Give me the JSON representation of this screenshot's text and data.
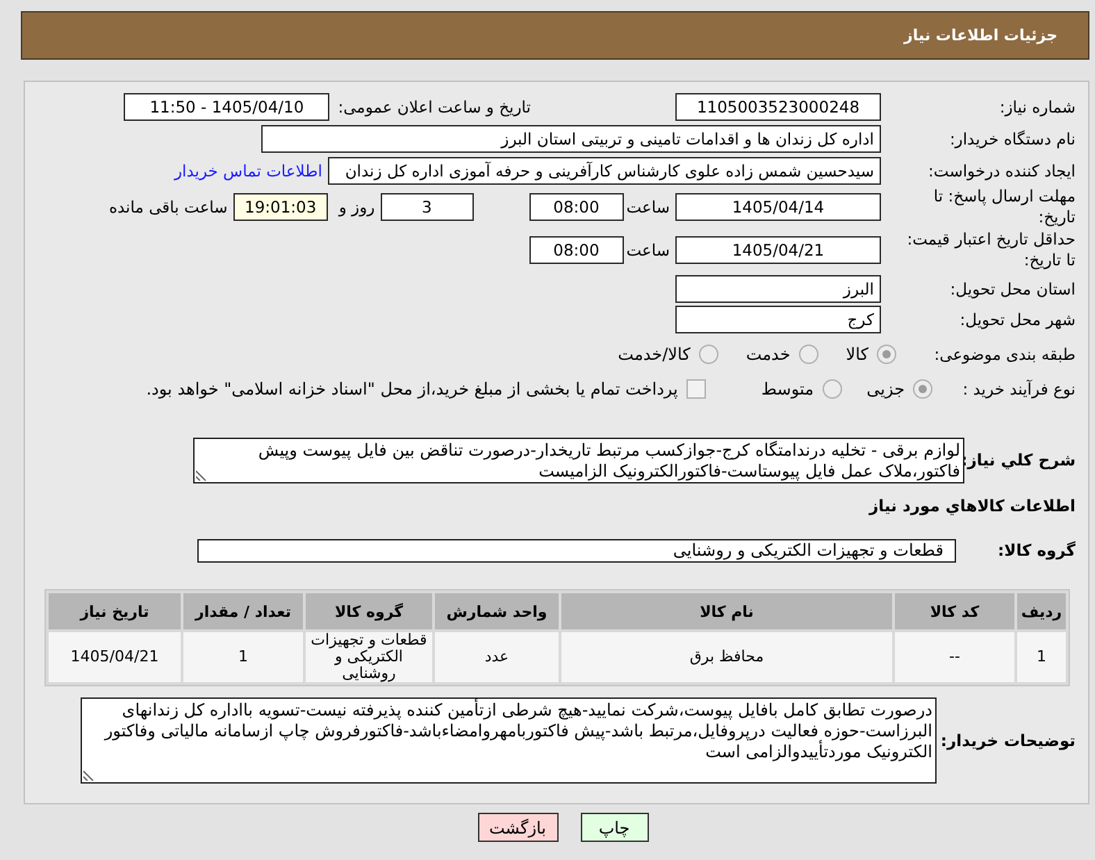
{
  "header": {
    "title": "جزئیات اطلاعات نیاز"
  },
  "form": {
    "need_number": {
      "label": "شماره نیاز:",
      "value": "1105003523000248"
    },
    "announce_datetime": {
      "label": "تاریخ و ساعت اعلان عمومی:",
      "value": "1405/04/10 - 11:50"
    },
    "buyer_org": {
      "label": "نام دستگاه خریدار:",
      "value": "اداره کل زندان ها و اقدامات تامینی و تربیتی استان البرز"
    },
    "requester": {
      "label": "ایجاد کننده درخواست:",
      "value": "سیدحسین شمس زاده علوی کارشناس کارآفرینی و حرفه آموزی اداره کل زندان",
      "link": "اطلاعات تماس خریدار"
    },
    "reply_deadline": {
      "label": "مهلت ارسال پاسخ: تا تاریخ:",
      "date": "1405/04/14",
      "time_label": "ساعت",
      "time": "08:00",
      "days": "3",
      "days_label": "روز و",
      "remaining": "19:01:03",
      "remaining_label": "ساعت باقی مانده"
    },
    "price_validity": {
      "label": "حداقل تاریخ اعتبار قیمت: تا تاریخ:",
      "date": "1405/04/21",
      "time_label": "ساعت",
      "time": "08:00"
    },
    "delivery_province": {
      "label": "استان محل تحویل:",
      "value": "البرز"
    },
    "delivery_city": {
      "label": "شهر محل تحویل:",
      "value": "کرج"
    },
    "category": {
      "label": "طبقه بندی موضوعی:",
      "options": [
        {
          "label": "کالا",
          "selected": true
        },
        {
          "label": "خدمت",
          "selected": false
        },
        {
          "label": "کالا/خدمت",
          "selected": false
        }
      ]
    },
    "purchase_type": {
      "label": "نوع فرآیند خرید :",
      "options": [
        {
          "label": "جزیی",
          "selected": true
        },
        {
          "label": "متوسط",
          "selected": false
        }
      ],
      "treasury_payment": {
        "label": "پرداخت تمام یا بخشی از مبلغ خرید،از محل \"اسناد خزانه اسلامی\" خواهد بود.",
        "checked": false
      }
    }
  },
  "description": {
    "label": "شرح کلي نياز:",
    "text": "لوازم برقی - تخلیه درندامتگاه کرج-جوازکسب مرتبط تاریخدار-درصورت تناقض بین فایل پیوست وپیش فاکتور،ملاک عمل فایل پیوستاست-فاکتورالکترونیک الزامیست"
  },
  "goods": {
    "title": "اطلاعات کالاهاي مورد نياز",
    "group_label": "گروه کالا:",
    "group_value": "قطعات و تجهیزات الکتریکی و روشنایی"
  },
  "table": {
    "columns": [
      "ردیف",
      "کد کالا",
      "نام کالا",
      "واحد شمارش",
      "گروه کالا",
      "تعداد / مقدار",
      "تاریخ نیاز"
    ],
    "rows": [
      [
        "1",
        "--",
        "محافظ برق",
        "عدد",
        "قطعات و تجهیزات الکتریکی و روشنایی",
        "1",
        "1405/04/21"
      ]
    ]
  },
  "buyer_notes": {
    "label": "توضیحات خریدار:",
    "text": "درصورت تطابق کامل بافایل پیوست،شرکت نمایید-هیچ شرطی ازتأمین کننده پذیرفته نیست-تسویه بااداره کل زندانهای البرزاست-حوزه فعالیت درپروفایل،مرتبط باشد-پیش فاکتوربامهروامضاءباشد-فاکتورفروش چاپ ازسامانه مالیاتی وفاکتور الکترونیک موردتأییدوالزامی است"
  },
  "buttons": [
    {
      "label": "چاپ",
      "kind": "print"
    },
    {
      "label": "بازگشت",
      "kind": "back"
    }
  ]
}
